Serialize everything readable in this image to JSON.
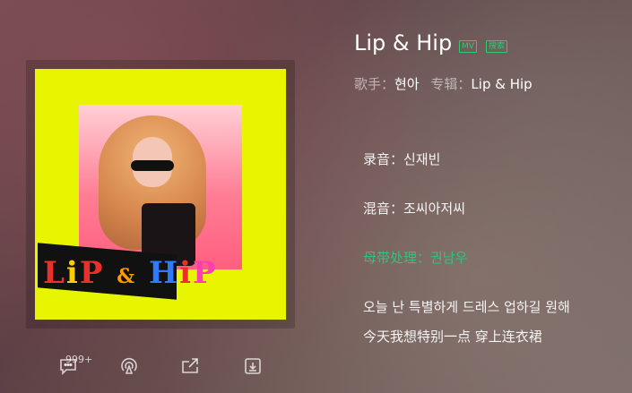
{
  "song": {
    "title": "Lip & Hip",
    "tags": [
      "MV",
      "搜索"
    ],
    "singer_label": "歌手：",
    "singer": "현아",
    "album_label": "专辑：",
    "album": "Lip & Hip"
  },
  "cover": {
    "logo_text": "LiP & HiP"
  },
  "actions": {
    "comment_count": "999+",
    "icons": [
      "comment-icon",
      "broadcast-icon",
      "share-icon",
      "download-icon"
    ]
  },
  "lyrics": [
    {
      "text": "录音：신재빈",
      "highlight": false
    },
    {
      "text": "混音：조씨아저씨",
      "highlight": false
    },
    {
      "text": "母带处理：권남우",
      "highlight": true
    },
    {
      "text": "오늘 난 특별하게 드레스 업하길 원해",
      "highlight": false
    },
    {
      "text": "今天我想特别一点 穿上连衣裙",
      "highlight": false
    }
  ],
  "colors": {
    "accent": "#31c27c",
    "cover_bg": "#e7f500"
  }
}
